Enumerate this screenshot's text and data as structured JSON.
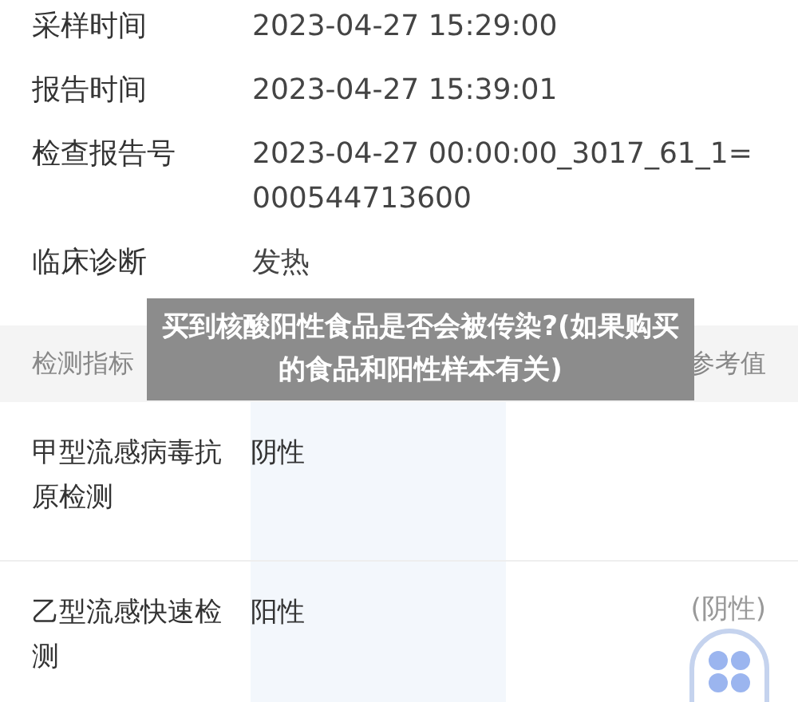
{
  "info": [
    {
      "label": "采样时间",
      "value": "2023-04-27 15:29:00"
    },
    {
      "label": "报告时间",
      "value": "2023-04-27 15:39:01"
    },
    {
      "label": "检查报告号",
      "value": "2023-04-27 00:00:00_3017_61_1=000544713600"
    },
    {
      "label": "临床诊断",
      "value": "发热"
    }
  ],
  "table": {
    "columns": [
      {
        "label": "检测指标"
      },
      {
        "label": "参考值"
      }
    ],
    "rows": [
      {
        "indicator": "甲型流感病毒抗原检测",
        "result": "阴性"
      },
      {
        "indicator": "乙型流感快速检测",
        "result": "阳性",
        "reference": "(阴性)"
      }
    ]
  },
  "caption": "买到核酸阳性食品是否会被传染?(如果购买的食品和阳性样本有关)"
}
